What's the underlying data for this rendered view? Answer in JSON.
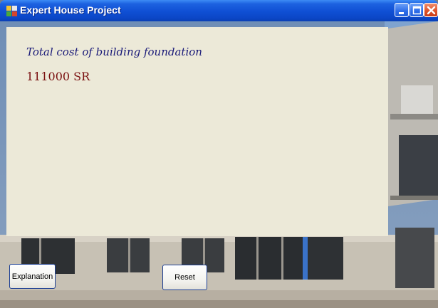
{
  "window": {
    "title": "Expert House Project",
    "app_icon": "app-icon",
    "controls": [
      "minimize-icon",
      "maximize-icon",
      "close-icon"
    ]
  },
  "result": {
    "heading": "Total cost of building foundation",
    "value": "111000 SR"
  },
  "buttons": {
    "explanation_label": "Explanation",
    "reset_label": "Reset"
  },
  "colors": {
    "titlebar": "#0f4fd4",
    "panel": "#ece9d8",
    "heading_text": "#1a1a78",
    "value_text": "#7a1010"
  }
}
